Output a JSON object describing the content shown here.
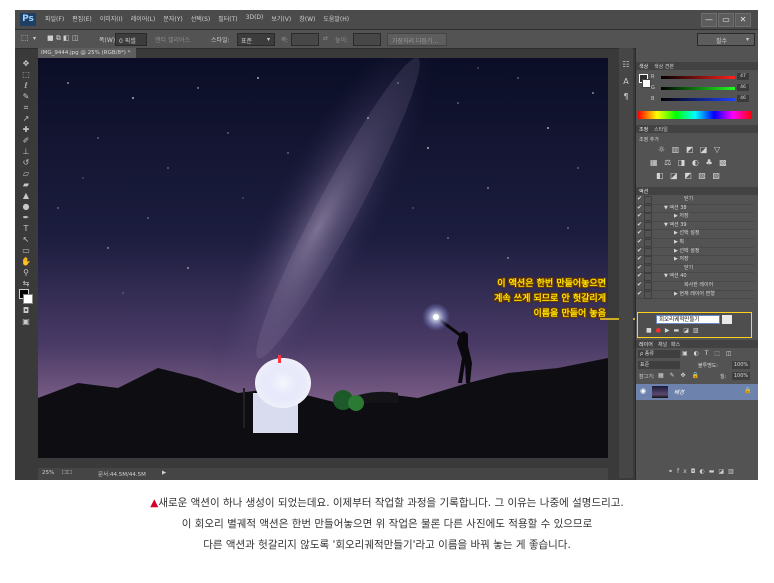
{
  "app": {
    "logo": "Ps",
    "menu": [
      "파일(F)",
      "편집(E)",
      "이미지(I)",
      "레이어(L)",
      "문자(Y)",
      "선택(S)",
      "필터(T)",
      "3D(D)",
      "보기(V)",
      "창(W)",
      "도움말(H)"
    ],
    "window_controls": [
      "—",
      "▭",
      "✕"
    ]
  },
  "options_bar": {
    "width_label": "폭(W)",
    "width_value": "0 픽셀",
    "antialias_label": "앤티 앨리어스",
    "style_label": "스타일:",
    "style_value": "표준",
    "height_label": "높이:",
    "refine_button": "가장자리 다듬기...",
    "workspace": "필수"
  },
  "document": {
    "tab_title": "IMG_9444.jpg @ 25% (RGB/8*) *",
    "zoom": "25%",
    "doc_size": "문서:44.5M/44.5M"
  },
  "panels": {
    "color": {
      "tabs": [
        "색상",
        "색상 견본"
      ],
      "sliders": [
        {
          "label": "R",
          "value": "47"
        },
        {
          "label": "G",
          "value": "46"
        },
        {
          "label": "B",
          "value": "46"
        }
      ]
    },
    "adjustments": {
      "tabs": [
        "조정",
        "스타일"
      ],
      "hint": "조정 추가"
    },
    "actions": {
      "tab": "액션",
      "rows": [
        {
          "label": "닫기",
          "indent": 3
        },
        {
          "label": "▼ 액션 38",
          "indent": 1
        },
        {
          "label": "▶ 저장",
          "indent": 2
        },
        {
          "label": "▼ 액션 39",
          "indent": 1
        },
        {
          "label": "▶ 선택 설정",
          "indent": 2
        },
        {
          "label": "▶ 획",
          "indent": 2
        },
        {
          "label": "▶ 선택 설정",
          "indent": 2
        },
        {
          "label": "▶ 저장",
          "indent": 2
        },
        {
          "label": "닫기",
          "indent": 3
        },
        {
          "label": "▼ 액션 40",
          "indent": 1
        },
        {
          "label": "복사한 레이어",
          "indent": 3
        },
        {
          "label": "▶ 현재 레이어 변형",
          "indent": 2
        }
      ],
      "new_action_value": "회오리궤적만들기"
    },
    "layers": {
      "tabs": [
        "레이어",
        "채널",
        "패스"
      ],
      "kind_label": "ρ 종류",
      "blend_mode": "표준",
      "opacity_label": "불투명도:",
      "opacity_value": "100%",
      "lock_label": "잠그기:",
      "fill_label": "칠:",
      "fill_value": "100%",
      "layer_name": "배경"
    }
  },
  "annotation": {
    "lines": [
      "이 액션은 한번 만들어놓으면",
      "계속 쓰게 되므로 안 헛갈리게",
      "이름을 만들어 놓음"
    ],
    "color": "#ffe400"
  },
  "caption": {
    "marker": "▲",
    "lines": [
      "새로운 액션이 하나 생성이 되었는데요. 이제부터 작업할 과정을 기록합니다. 그 이유는 나중에 설명드리고.",
      "이 회오리 별궤적 액션은 한번 만들어놓으면 위 작업은 물론 다른 사진에도 적용할 수 있으므로",
      "다른 액션과 헛갈리지 않도록 '회오리궤적만들기'라고 이름을 바꿔 놓는 게 좋습니다."
    ]
  }
}
